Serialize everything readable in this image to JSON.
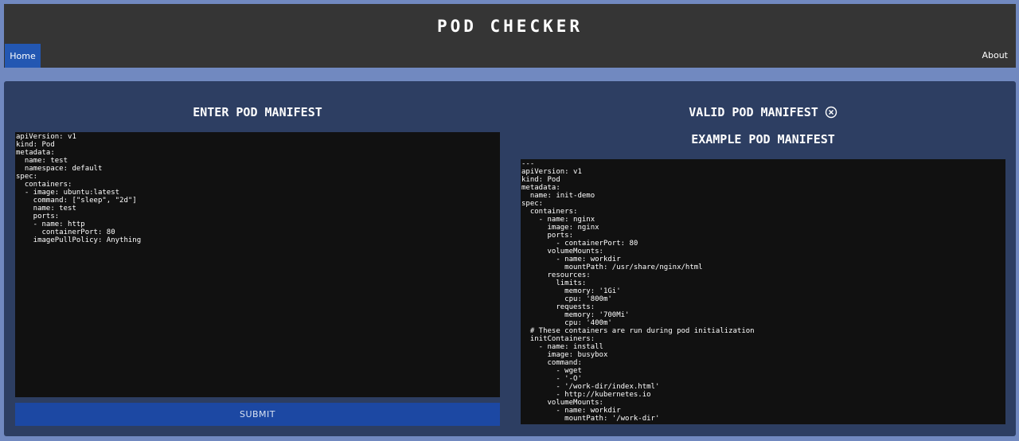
{
  "app": {
    "title": "POD CHECKER"
  },
  "nav": {
    "home": "Home",
    "about": "About"
  },
  "left": {
    "title": "ENTER POD MANIFEST",
    "editor_value": "apiVersion: v1\nkind: Pod\nmetadata:\n  name: test\n  namespace: default\nspec:\n  containers:\n  - image: ubuntu:latest\n    command: [\"sleep\", \"2d\"]\n    name: test\n    ports:\n    - name: http\n      containerPort: 80\n    imagePullPolicy: Anything",
    "submit_label": "SUBMIT"
  },
  "right": {
    "status_title": "VALID POD MANIFEST",
    "status_icon": "close-circle-icon",
    "example_title": "EXAMPLE POD MANIFEST",
    "example_text": "---\napiVersion: v1\nkind: Pod\nmetadata:\n  name: init-demo\nspec:\n  containers:\n    - name: nginx\n      image: nginx\n      ports:\n        - containerPort: 80\n      volumeMounts:\n        - name: workdir\n          mountPath: /usr/share/nginx/html\n      resources:\n        limits:\n          memory: '1Gi'\n          cpu: '800m'\n        requests:\n          memory: '700Mi'\n          cpu: '400m'\n  # These containers are run during pod initialization\n  initContainers:\n    - name: install\n      image: busybox\n      command:\n        - wget\n        - '-O'\n        - '/work-dir/index.html'\n        - http://kubernetes.io\n      volumeMounts:\n        - name: workdir\n          mountPath: '/work-dir'"
  },
  "colors": {
    "page_bg": "#7189c0",
    "header_bg": "#353535",
    "panel_bg": "#2d3e62",
    "accent": "#2357b2",
    "submit_bg": "#1c48a3",
    "editor_bg": "#111111"
  }
}
